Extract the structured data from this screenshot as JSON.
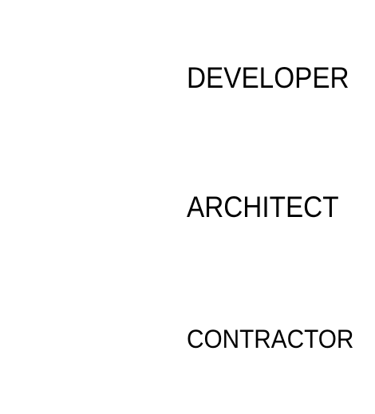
{
  "roles": [
    {
      "label": "DEVELOPER"
    },
    {
      "label": "ARCHITECT"
    },
    {
      "label": "CONTRACTOR"
    }
  ],
  "colors": {
    "text": "#000000",
    "background": "#ffffff"
  }
}
